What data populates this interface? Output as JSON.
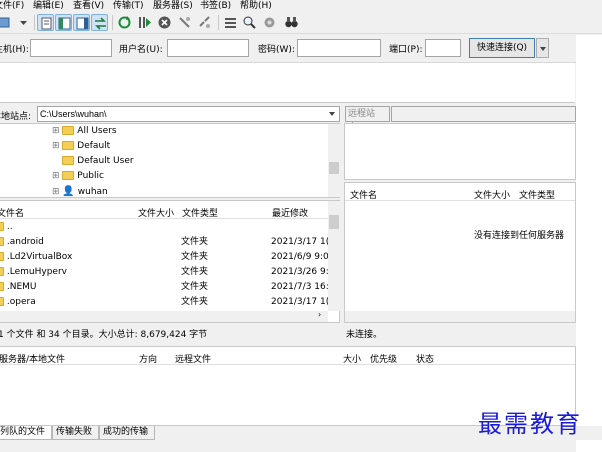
{
  "menu": [
    "文件(F)",
    "编辑(E)",
    "查看(V)",
    "传输(T)",
    "服务器(S)",
    "书签(B)",
    "帮助(H)"
  ],
  "quickconnect": {
    "host_label": "主机(H):",
    "user_label": "用户名(U):",
    "pass_label": "密码(W):",
    "port_label": "端口(P):",
    "connect_button": "快速连接(Q)"
  },
  "local": {
    "site_label": "本地站点:",
    "path": "C:\\Users\\wuhan\\",
    "tree": [
      "All Users",
      "Default",
      "Default User",
      "Public",
      "wuhan"
    ],
    "columns": [
      "文件名",
      "文件大小",
      "文件类型",
      "最近修改"
    ],
    "files": [
      {
        "name": "..",
        "size": "",
        "type": "",
        "modified": ""
      },
      {
        "name": ".android",
        "size": "",
        "type": "文件夹",
        "modified": "2021/3/17 1("
      },
      {
        "name": ".Ld2VirtualBox",
        "size": "",
        "type": "文件夹",
        "modified": "2021/6/9 9:0"
      },
      {
        "name": ".LemuHyperv",
        "size": "",
        "type": "文件夹",
        "modified": "2021/3/26 9:"
      },
      {
        "name": ".NEMU",
        "size": "",
        "type": "文件夹",
        "modified": "2021/7/3 16:"
      },
      {
        "name": ".opera",
        "size": "",
        "type": "文件夹",
        "modified": "2021/3/17 1("
      }
    ],
    "status": "1 个文件 和 34 个目录。大小总计: 8,679,424 字节"
  },
  "remote": {
    "site_label": "远程站点:",
    "columns": [
      "文件名",
      "文件大小",
      "文件类型"
    ],
    "empty_message": "没有连接到任何服务器",
    "status": "未连接。"
  },
  "queue": {
    "columns": [
      "服务器/本地文件",
      "方向",
      "远程文件",
      "大小",
      "优先级",
      "状态"
    ],
    "tabs": [
      "列队的文件",
      "传输失败",
      "成功的传输"
    ]
  },
  "watermark": "最需教育",
  "colors": {
    "accent": "#3c7fb1",
    "folder": "#f5cf55",
    "watermark": "#1b1bd6"
  }
}
